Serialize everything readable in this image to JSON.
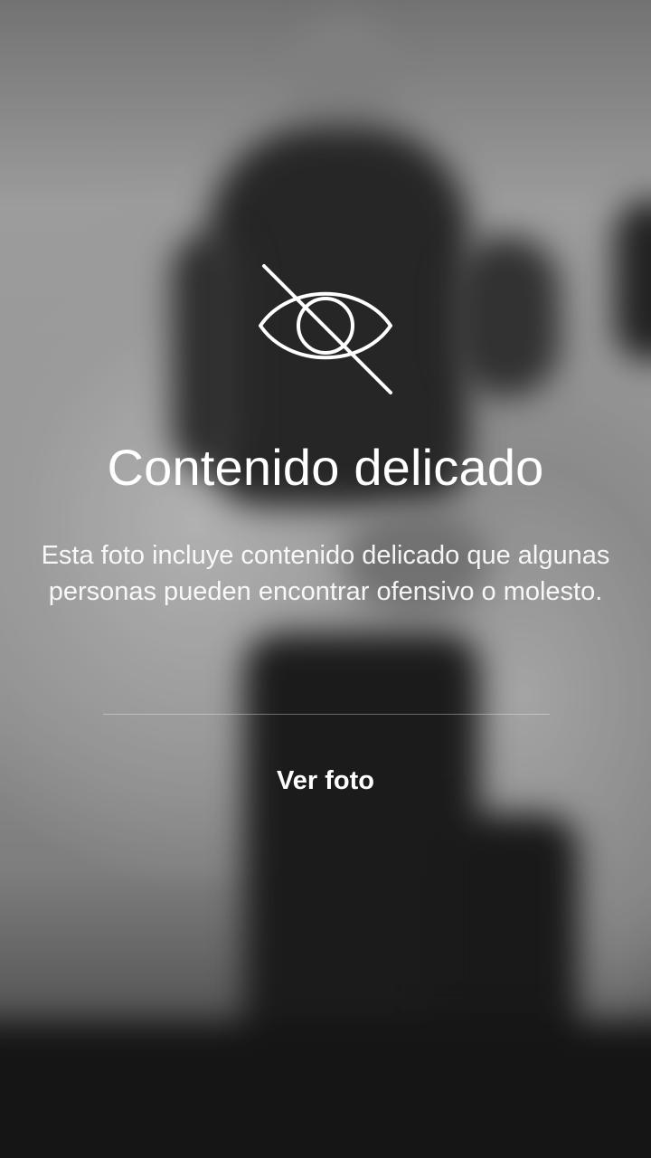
{
  "sensitive_content": {
    "icon": "eye-slash-icon",
    "title": "Contenido delicado",
    "description": "Esta foto incluye contenido delicado que algunas personas pueden encontrar ofensivo o molesto.",
    "view_button_label": "Ver foto"
  },
  "colors": {
    "text": "#ffffff",
    "divider": "#ffffff"
  }
}
